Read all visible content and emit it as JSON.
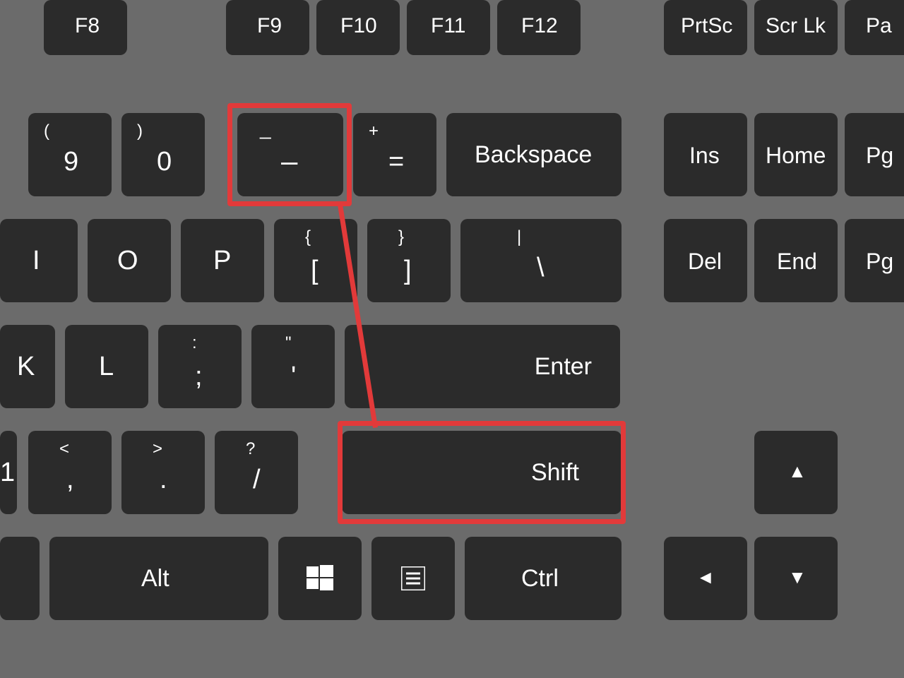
{
  "row_fn": {
    "f8": "F8",
    "f9": "F9",
    "f10": "F10",
    "f11": "F11",
    "f12": "F12",
    "prtsc": "PrtSc",
    "scrlk": "Scr Lk",
    "pa": "Pa"
  },
  "row_num": {
    "nine": {
      "top": "(",
      "main": "9"
    },
    "zero": {
      "top": ")",
      "main": "0"
    },
    "minus": {
      "top": "_",
      "main": "–"
    },
    "equals": {
      "top": "+",
      "main": "="
    },
    "backspace": "Backspace",
    "ins": "Ins",
    "home": "Home",
    "pg": "Pg"
  },
  "row_qwerty": {
    "i": "I",
    "o": "O",
    "p": "P",
    "lbracket": {
      "top": "{",
      "main": "["
    },
    "rbracket": {
      "top": "}",
      "main": "]"
    },
    "backslash": {
      "top": "|",
      "main": "\\"
    },
    "del": "Del",
    "end": "End",
    "pg2": "Pg"
  },
  "row_home": {
    "k": "K",
    "l": "L",
    "semicolon": {
      "top": ":",
      "main": ";"
    },
    "quote": {
      "top": "\"",
      "main": "'"
    },
    "enter": "Enter"
  },
  "row_shift": {
    "one": "1",
    "comma": {
      "top": "<",
      "main": ","
    },
    "period": {
      "top": ">",
      "main": "."
    },
    "slash": {
      "top": "?",
      "main": "/"
    },
    "shift": "Shift",
    "up": "▲"
  },
  "row_bottom": {
    "alt": "Alt",
    "ctrl": "Ctrl",
    "left": "◄",
    "down": "▼"
  }
}
